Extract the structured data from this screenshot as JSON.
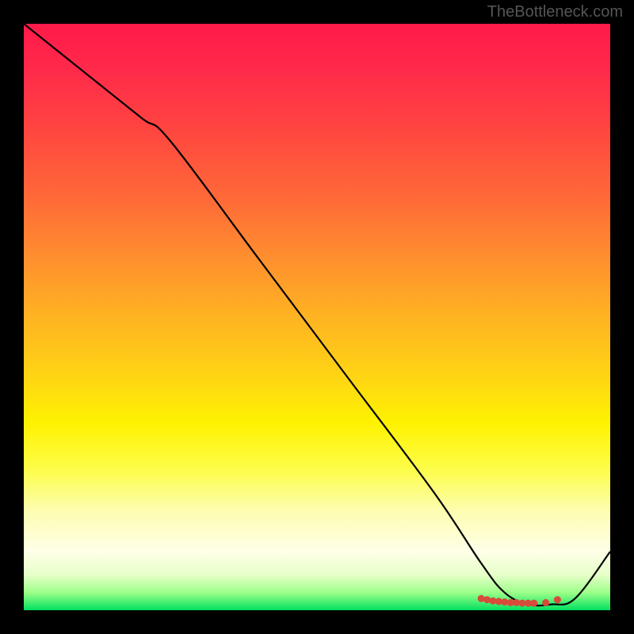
{
  "watermark": "TheBottleneck.com",
  "chart_data": {
    "type": "line",
    "title": "",
    "xlabel": "",
    "ylabel": "",
    "xlim": [
      0,
      100
    ],
    "ylim": [
      0,
      100
    ],
    "grid": false,
    "legend": false,
    "line": {
      "x": [
        0,
        10,
        20,
        25,
        40,
        55,
        70,
        78,
        82,
        86,
        90,
        94,
        100
      ],
      "y": [
        100,
        92,
        84,
        80,
        60,
        40,
        20,
        8,
        3,
        1,
        1,
        2,
        10
      ]
    },
    "markers": {
      "x": [
        78,
        79,
        80,
        81,
        82,
        83,
        84,
        85,
        86,
        87,
        89,
        91
      ],
      "y": [
        2.0,
        1.8,
        1.6,
        1.5,
        1.4,
        1.3,
        1.3,
        1.2,
        1.2,
        1.2,
        1.3,
        1.8
      ]
    },
    "background": "vertical-gradient red→yellow→green"
  }
}
